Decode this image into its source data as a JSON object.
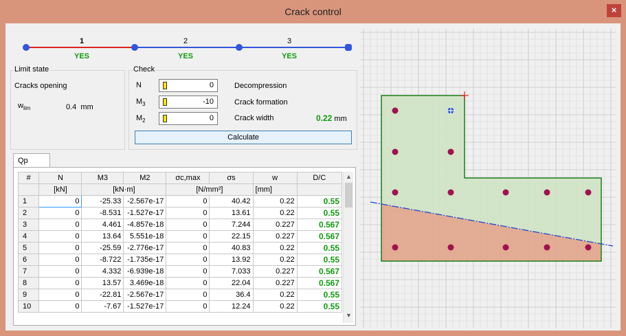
{
  "window": {
    "title": "Crack control",
    "close_glyph": "×"
  },
  "stepper": {
    "steps": [
      {
        "number": "1",
        "status": "YES"
      },
      {
        "number": "2",
        "status": "YES"
      },
      {
        "number": "3",
        "status": "YES"
      }
    ]
  },
  "limit_state": {
    "legend": "Limit state",
    "type": "Cracks opening",
    "wlim_label": "w",
    "wlim_sub": "lim",
    "wlim_value": "0.4",
    "wlim_unit": "mm"
  },
  "check": {
    "legend": "Check",
    "n_label": "N",
    "n_value": "0",
    "m3_label": "M",
    "m3_sub": "3",
    "m3_value": "-10",
    "m2_label": "M",
    "m2_sub": "2",
    "m2_value": "0",
    "decompression": "Decompression",
    "crack_formation": "Crack formation",
    "crack_width_label": "Crack width",
    "crack_width_value": "0.22",
    "crack_width_unit": "mm",
    "calculate_label": "Calculate"
  },
  "tabs": {
    "active": "Qp"
  },
  "table": {
    "headers": [
      "#",
      "N",
      "M3",
      "M2",
      "σc,max",
      "σs",
      "w",
      "D/C"
    ],
    "units": {
      "n": "[kN]",
      "m": "[kN·m]",
      "stress": "[N/mm²]",
      "w": "[mm]"
    },
    "rows": [
      [
        "1",
        "0",
        "-25.33",
        "-2.567e-17",
        "0",
        "40.42",
        "0.22",
        "0.55"
      ],
      [
        "2",
        "0",
        "-8.531",
        "-1.527e-17",
        "0",
        "13.61",
        "0.22",
        "0.55"
      ],
      [
        "3",
        "0",
        "4.461",
        "-4.857e-18",
        "0",
        "7.244",
        "0.227",
        "0.567"
      ],
      [
        "4",
        "0",
        "13.64",
        "5.551e-18",
        "0",
        "22.15",
        "0.227",
        "0.567"
      ],
      [
        "5",
        "0",
        "-25.59",
        "-2.776e-17",
        "0",
        "40.83",
        "0.22",
        "0.55"
      ],
      [
        "6",
        "0",
        "-8.722",
        "-1.735e-17",
        "0",
        "13.92",
        "0.22",
        "0.55"
      ],
      [
        "7",
        "0",
        "4.332",
        "-6.939e-18",
        "0",
        "7.033",
        "0.227",
        "0.567"
      ],
      [
        "8",
        "0",
        "13.57",
        "3.469e-18",
        "0",
        "22.04",
        "0.227",
        "0.567"
      ],
      [
        "9",
        "0",
        "-22.81",
        "-2.567e-17",
        "0",
        "36.4",
        "0.22",
        "0.55"
      ],
      [
        "10",
        "0",
        "-7.67",
        "-1.527e-17",
        "0",
        "12.24",
        "0.22",
        "0.55"
      ]
    ]
  },
  "colors": {
    "title_bar": "#d9957c",
    "ok_green": "#119911",
    "step_red": "#dd2222",
    "step_blue": "#3355dd",
    "section_compressed": "#cfe3c3",
    "section_tension": "#e2a88e",
    "section_outline": "#1a7a1a",
    "rebar": "#a0124e",
    "neutral_axis": "#2244cc"
  },
  "icons": {
    "close": "close-icon",
    "cursor": "input-cursor-icon",
    "scroll_up": "chevron-up-icon",
    "scroll_down": "chevron-down-icon"
  }
}
